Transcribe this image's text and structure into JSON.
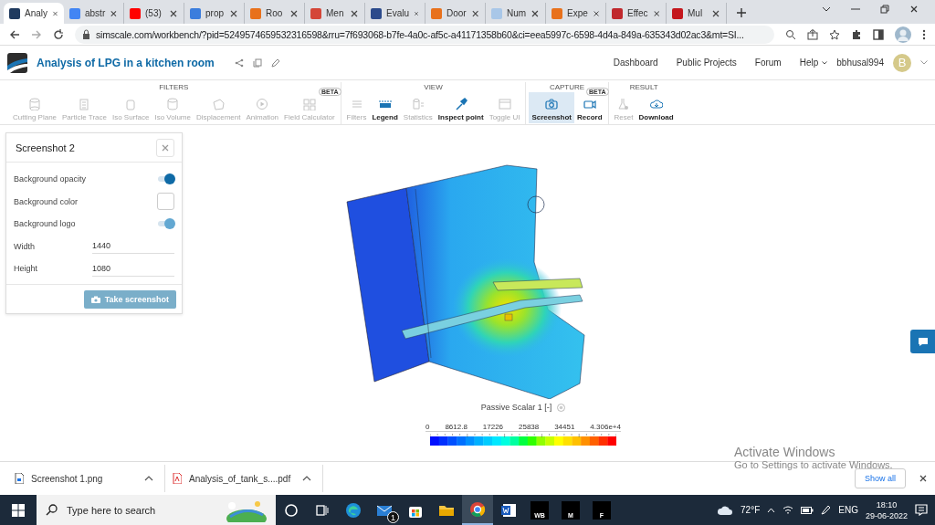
{
  "browser": {
    "tabs": [
      {
        "title": "Analy",
        "color": "#1f3a5f",
        "selected": true
      },
      {
        "title": "abstr",
        "color": "#4285f4",
        "selected": false
      },
      {
        "title": "(53)",
        "color": "#ff0000",
        "selected": false
      },
      {
        "title": "prop",
        "color": "#3b7ddd",
        "selected": false
      },
      {
        "title": "Roo",
        "color": "#e8711c",
        "selected": false
      },
      {
        "title": "Men",
        "color": "#d44638",
        "selected": false
      },
      {
        "title": "Evalu",
        "color": "#2b4a8b",
        "selected": false
      },
      {
        "title": "Door",
        "color": "#e8711c",
        "selected": false
      },
      {
        "title": "Num",
        "color": "#a9c7e8",
        "selected": false
      },
      {
        "title": "Expe",
        "color": "#e8711c",
        "selected": false
      },
      {
        "title": "Effec",
        "color": "#c0282d",
        "selected": false
      },
      {
        "title": "Mul",
        "color": "#c4161c",
        "selected": false
      }
    ],
    "url": "simscale.com/workbench/?pid=5249574659532316598&rru=7f693068-b7fe-4a0c-af5c-a41171358b60&ci=eea5997c-6598-4d4a-849a-635343d02ac3&mt=SI..."
  },
  "app": {
    "title": "Analysis of LPG in a kitchen room",
    "nav": [
      "Dashboard",
      "Public Projects",
      "Forum",
      "Help"
    ],
    "user": "bbhusal994",
    "avatar": "B"
  },
  "toolbar": {
    "groups": [
      {
        "title": "FILTERS",
        "tools": [
          {
            "label": "Cutting Plane",
            "disabled": true,
            "selected": false
          },
          {
            "label": "Particle Trace",
            "disabled": true,
            "selected": false
          },
          {
            "label": "Iso Surface",
            "disabled": true,
            "selected": false
          },
          {
            "label": "Iso Volume",
            "disabled": true,
            "selected": false
          },
          {
            "label": "Displacement",
            "disabled": true,
            "selected": false
          },
          {
            "label": "Animation",
            "disabled": true,
            "selected": false
          },
          {
            "label": "Field Calculator",
            "disabled": true,
            "selected": false,
            "badge": "BETA"
          }
        ]
      },
      {
        "title": "VIEW",
        "tools": [
          {
            "label": "Filters",
            "disabled": true,
            "selected": false
          },
          {
            "label": "Legend",
            "disabled": false,
            "selected": false
          },
          {
            "label": "Statistics",
            "disabled": true,
            "selected": false
          },
          {
            "label": "Inspect point",
            "disabled": false,
            "selected": false
          },
          {
            "label": "Toggle UI",
            "disabled": true,
            "selected": false
          }
        ]
      },
      {
        "title": "CAPTURE",
        "tools": [
          {
            "label": "Screenshot",
            "disabled": false,
            "selected": true
          },
          {
            "label": "Record",
            "disabled": false,
            "selected": false,
            "badge": "BETA"
          }
        ]
      },
      {
        "title": "RESULT",
        "tools": [
          {
            "label": "Reset",
            "disabled": true,
            "selected": false
          },
          {
            "label": "Download",
            "disabled": false,
            "selected": false
          }
        ]
      }
    ]
  },
  "panel": {
    "title": "Screenshot 2",
    "rows": [
      {
        "kind": "toggle",
        "label": "Background opacity",
        "on": true,
        "disabled": false
      },
      {
        "kind": "color",
        "label": "Background color"
      },
      {
        "kind": "toggle",
        "label": "Background logo",
        "on": true,
        "disabled": true
      },
      {
        "kind": "number",
        "label": "Width",
        "value": "1440"
      },
      {
        "kind": "number",
        "label": "Height",
        "value": "1080"
      }
    ],
    "button": "Take screenshot",
    "button_disabled": true
  },
  "legend": {
    "title": "Passive Scalar 1 [-]",
    "ticks": [
      "0",
      "8612.8",
      "17226",
      "25838",
      "34451",
      "4.306e+4"
    ]
  },
  "downloads": {
    "items": [
      {
        "name": "Screenshot 1.png",
        "kind": "image"
      },
      {
        "name": "Analysis_of_tank_s....pdf",
        "kind": "pdf"
      }
    ],
    "show_all": "Show all"
  },
  "os_notice": {
    "title": "Activate Windows",
    "text": "Go to Settings to activate Windows."
  },
  "taskbar": {
    "search_placeholder": "Type here to search",
    "apps": [
      {
        "kind": "cortana",
        "selected": false
      },
      {
        "kind": "taskview",
        "selected": false
      },
      {
        "kind": "edge",
        "selected": false
      },
      {
        "kind": "mail",
        "selected": false,
        "badge": "1"
      },
      {
        "kind": "store",
        "selected": false
      },
      {
        "kind": "folder",
        "selected": false
      },
      {
        "kind": "chrome",
        "selected": true
      },
      {
        "kind": "word",
        "selected": false
      },
      {
        "kind": "tile",
        "selected": false,
        "label": "WB"
      },
      {
        "kind": "tile",
        "selected": false,
        "label": "M"
      },
      {
        "kind": "tile",
        "selected": false,
        "label": "F"
      }
    ],
    "weather": "72°F",
    "language": "ENG",
    "time": "18:10",
    "date": "29-06-2022"
  }
}
